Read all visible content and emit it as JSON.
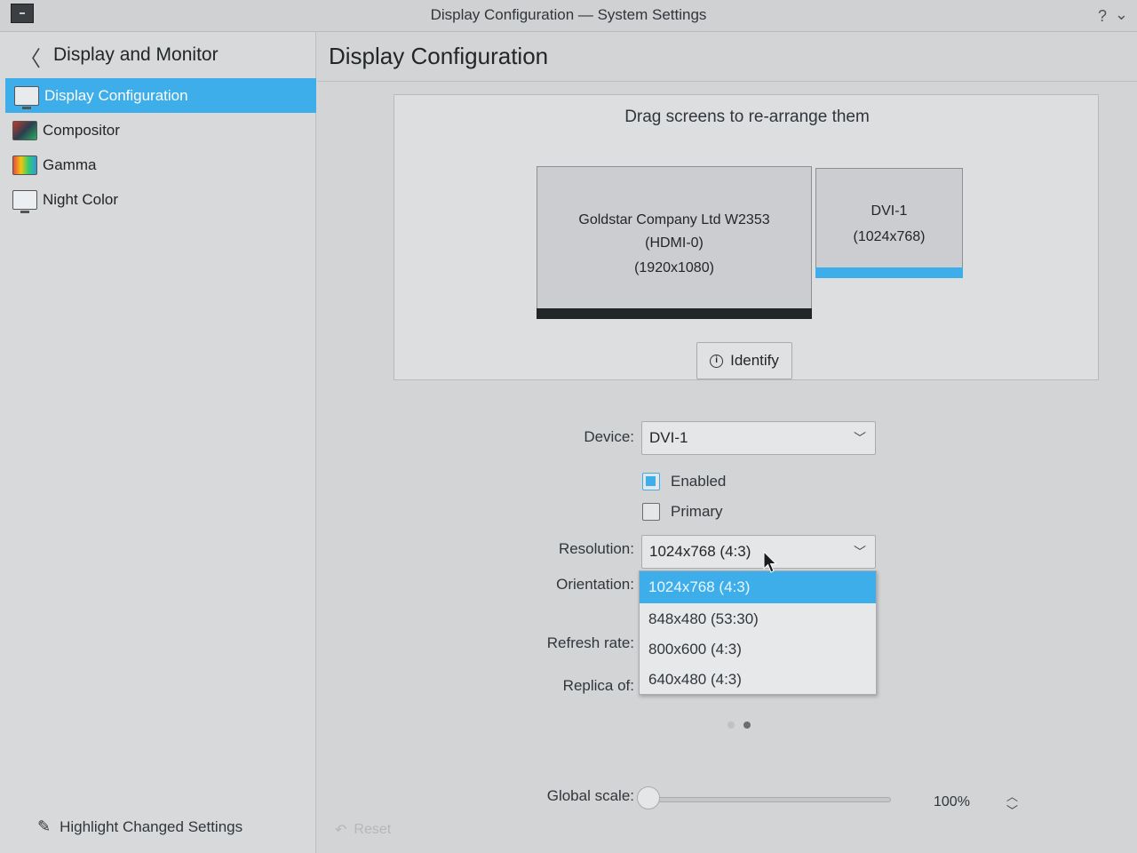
{
  "window": {
    "title": "Display Configuration — System Settings",
    "help_icon": "?",
    "menu_icon": "⌄"
  },
  "sidebar": {
    "heading": "Display and Monitor",
    "back_icon": "〈",
    "items": [
      {
        "label": "Display Configuration",
        "icon": "display-icon",
        "active": true
      },
      {
        "label": "Compositor",
        "icon": "compositor-icon",
        "active": false
      },
      {
        "label": "Gamma",
        "icon": "gamma-icon",
        "active": false
      },
      {
        "label": "Night Color",
        "icon": "night-color-icon",
        "active": false
      }
    ],
    "footer": {
      "label": "Highlight Changed Settings",
      "icon": "✎"
    }
  },
  "main": {
    "title": "Display Configuration",
    "arrange": {
      "hint": "Drag screens to re-arrange them",
      "screens": [
        {
          "line1": "Goldstar Company Ltd W2353",
          "line2": "(HDMI-0)",
          "line3": "(1920x1080)"
        },
        {
          "line1": "DVI-1",
          "line2": "(1024x768)"
        }
      ],
      "identify": {
        "label": "Identify",
        "icon": "i"
      }
    },
    "form": {
      "device_label": "Device:",
      "device_value": "DVI-1",
      "enabled_label": "Enabled",
      "enabled_checked": true,
      "primary_label": "Primary",
      "primary_checked": false,
      "resolution_label": "Resolution:",
      "resolution_value": "1024x768 (4:3)",
      "orientation_label": "Orientation:",
      "refresh_label": "Refresh rate:",
      "replica_label": "Replica of:",
      "resolution_options": [
        "1024x768 (4:3)",
        "848x480 (53:30)",
        "800x600 (4:3)",
        "640x480 (4:3)"
      ],
      "chevron": "﹀"
    },
    "scale": {
      "label": "Global scale:",
      "value": "100%",
      "up": "︿",
      "down": "﹀"
    },
    "reset": {
      "label": "Reset",
      "icon": "↶"
    }
  },
  "colors": {
    "accent": "#3daee9",
    "primary_screen_bar": "#232627"
  }
}
